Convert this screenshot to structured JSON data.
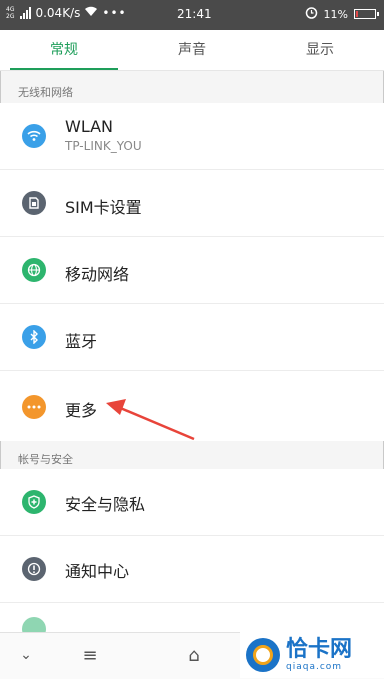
{
  "status_bar": {
    "network_types": [
      "4G",
      "2G"
    ],
    "speed": "0.04K/s",
    "dots": "•••",
    "time": "21:41",
    "battery_percent": "11%",
    "battery_level": 0.11
  },
  "tabs": [
    {
      "label": "常规",
      "active": true
    },
    {
      "label": "声音",
      "active": false
    },
    {
      "label": "显示",
      "active": false
    }
  ],
  "sections": {
    "wireless": "无线和网络",
    "account": "帐号与安全"
  },
  "items": {
    "wlan": {
      "title": "WLAN",
      "subtitle": "TP-LINK_YOU",
      "icon": "wifi-icon",
      "color": "#3aa0e8"
    },
    "sim": {
      "title": "SIM卡设置",
      "icon": "sim-card-icon",
      "color": "#5b6470"
    },
    "mobile": {
      "title": "移动网络",
      "icon": "globe-icon",
      "color": "#2db56e"
    },
    "bluetooth": {
      "title": "蓝牙",
      "icon": "bluetooth-icon",
      "color": "#3aa0e8"
    },
    "more": {
      "title": "更多",
      "icon": "more-dots-icon",
      "color": "#f3962c"
    },
    "security": {
      "title": "安全与隐私",
      "icon": "shield-icon",
      "color": "#2db56e"
    },
    "notification": {
      "title": "通知中心",
      "icon": "alert-icon",
      "color": "#5b6470"
    }
  },
  "navbar": {
    "back": "⌄",
    "menu": "≡",
    "home": "⌂"
  },
  "watermark": {
    "title": "恰卡网",
    "url": "qiaqa.com"
  },
  "colors": {
    "accent": "#1e9e5a",
    "arrow": "#e8443a"
  }
}
